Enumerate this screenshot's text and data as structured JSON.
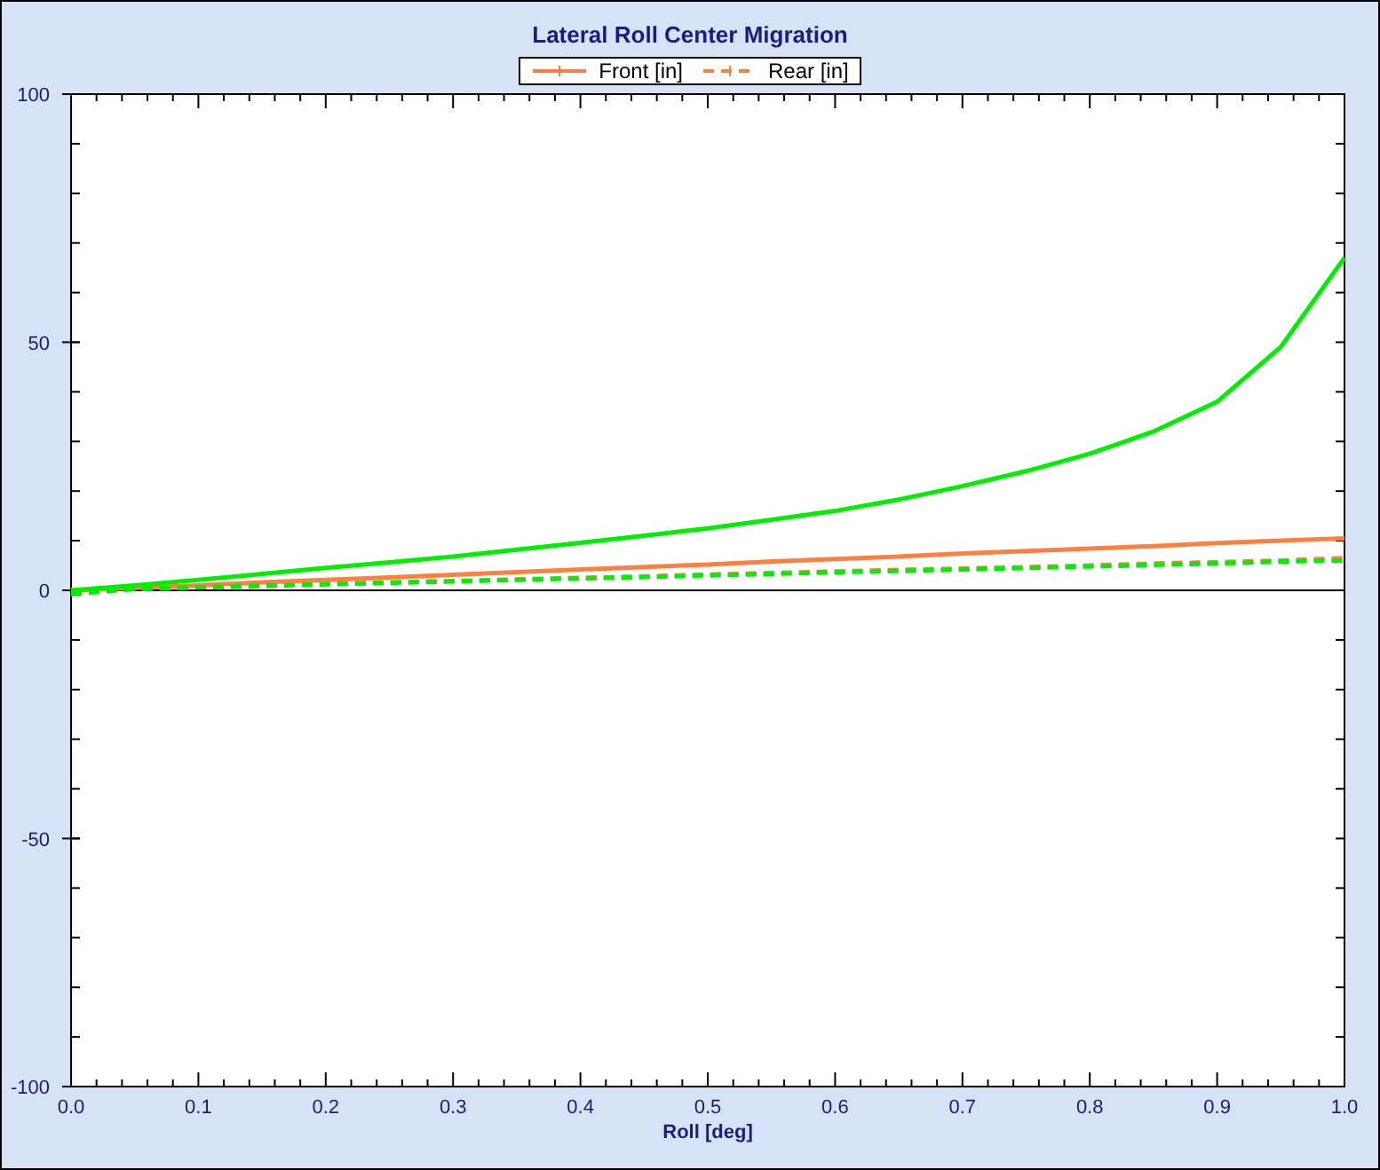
{
  "chart": {
    "chart_data": {
      "type": "line",
      "title": "Lateral Roll Center Migration",
      "xlabel": "Roll [deg]",
      "x": [
        0,
        0.05,
        0.1,
        0.15,
        0.2,
        0.25,
        0.3,
        0.35,
        0.4,
        0.45,
        0.5,
        0.55,
        0.6,
        0.65,
        0.7,
        0.75,
        0.8,
        0.85,
        0.9,
        0.95,
        1.0
      ],
      "series": [
        {
          "name": "Front [in]",
          "line_style": "solid",
          "color": "#ff7f3f",
          "values": [
            0,
            0.5,
            1.0,
            1.6,
            2.1,
            2.6,
            3.1,
            3.7,
            4.2,
            4.7,
            5.2,
            5.8,
            6.3,
            6.8,
            7.4,
            7.9,
            8.4,
            8.9,
            9.5,
            10,
            10.5
          ]
        },
        {
          "name": "Rear [in]",
          "line_style": "dashed",
          "color": "#ff7f3f",
          "values": [
            0,
            0.3,
            0.6,
            0.9,
            1.3,
            1.6,
            1.9,
            2.2,
            2.5,
            2.8,
            3.2,
            3.5,
            3.8,
            4.1,
            4.4,
            4.7,
            5,
            5.4,
            5.7,
            6,
            6.5
          ]
        },
        {
          "line_style": "solid",
          "color": "#00ee00",
          "values": [
            0,
            1,
            2.1,
            3.3,
            4.5,
            5.6,
            6.8,
            8.2,
            9.6,
            11,
            12.5,
            14.2,
            16,
            18.3,
            21,
            24,
            27.5,
            32,
            38,
            49,
            67
          ]
        },
        {
          "line_style": "dashed",
          "color": "#00ee00",
          "values": [
            -0.8,
            0.3,
            0.6,
            0.9,
            1.2,
            1.5,
            1.8,
            2.1,
            2.4,
            2.7,
            3.0,
            3.3,
            3.6,
            3.9,
            4.2,
            4.5,
            4.8,
            5.1,
            5.4,
            5.8,
            6.0
          ]
        }
      ],
      "xlim": [
        0,
        1
      ],
      "ylim": [
        -100,
        100
      ],
      "xticks": [
        {
          "value": 0,
          "label": "0.0"
        },
        {
          "value": 0.1,
          "label": "0.1"
        },
        {
          "value": 0.2,
          "label": "0.2"
        },
        {
          "value": 0.3,
          "label": "0.3"
        },
        {
          "value": 0.4,
          "label": "0.4"
        },
        {
          "value": 0.5,
          "label": "0.5"
        },
        {
          "value": 0.6,
          "label": "0.6"
        },
        {
          "value": 0.7,
          "label": "0.7"
        },
        {
          "value": 0.8,
          "label": "0.8"
        },
        {
          "value": 0.9,
          "label": "0.9"
        },
        {
          "value": 1,
          "label": "1.0"
        }
      ],
      "yticks": [
        -100,
        -50,
        0,
        50,
        100
      ]
    }
  }
}
